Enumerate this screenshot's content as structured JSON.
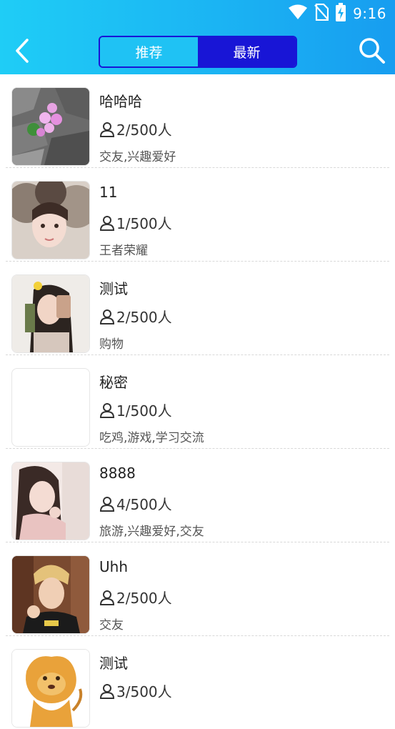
{
  "status": {
    "time": "9:16"
  },
  "nav": {
    "tabs": [
      {
        "label": "推荐",
        "active": false
      },
      {
        "label": "最新",
        "active": true
      }
    ]
  },
  "colors": {
    "header": "#1bb4f3",
    "tab_active": "#1815d6",
    "tab_inactive": "#1fc2f4"
  },
  "rooms": [
    {
      "name": "哈哈哈",
      "members": "2/500人",
      "tags": "交友,兴趣爱好",
      "thumb": "flower-photo"
    },
    {
      "name": "11",
      "members": "1/500人",
      "tags": "王者荣耀",
      "thumb": "girl-fur-photo"
    },
    {
      "name": "测试",
      "members": "2/500人",
      "tags": "购物",
      "thumb": "girl-selfie-photo"
    },
    {
      "name": "秘密",
      "members": "1/500人",
      "tags": "吃鸡,游戏,学习交流",
      "thumb": "blank"
    },
    {
      "name": "8888",
      "members": "4/500人",
      "tags": "旅游,兴趣爱好,交友",
      "thumb": "girl-pink-photo"
    },
    {
      "name": "Uhh",
      "members": "2/500人",
      "tags": "交友",
      "thumb": "boy-photo"
    },
    {
      "name": "测试",
      "members": "3/500人",
      "tags": "",
      "thumb": "lion-cartoon"
    }
  ]
}
